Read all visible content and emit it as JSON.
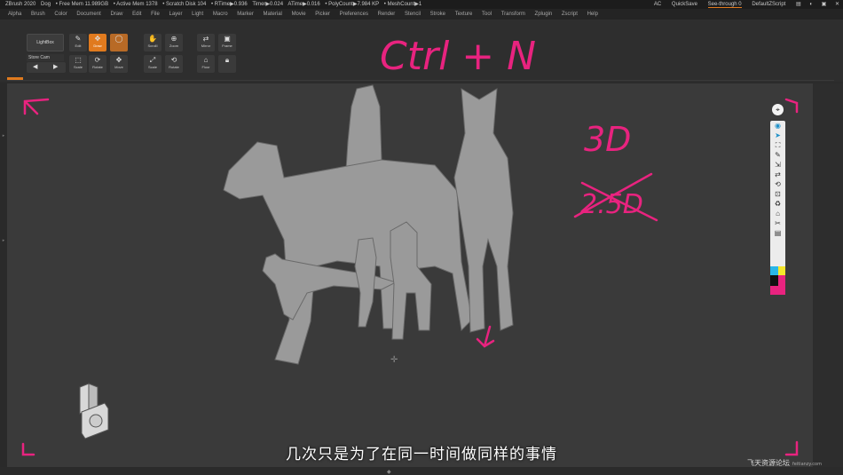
{
  "titlebar": {
    "app_name": "ZBrush 2020",
    "document": "Dog",
    "free_mem": "• Free Mem 11.989GB",
    "active_mem": "• Active Mem 1378",
    "scratch_disk": "• Scratch Disk 104",
    "rtime": "• RTime▶0.936",
    "timer": "Timer▶0.024",
    "atime": "ATime▶0.016",
    "polycount": "• PolyCount▶7.984 KP",
    "meshcount": "• MeshCount▶1",
    "ac": "AC",
    "quicksave": "QuickSave",
    "see_through": "See-through  0",
    "script": "DefaultZScript"
  },
  "menu": [
    "Alpha",
    "Brush",
    "Color",
    "Document",
    "Draw",
    "Edit",
    "File",
    "Layer",
    "Light",
    "Macro",
    "Marker",
    "Material",
    "Movie",
    "Picker",
    "Preferences",
    "Render",
    "Stencil",
    "Stroke",
    "Texture",
    "Tool",
    "Transform",
    "Zplugin",
    "Zscript",
    "Help"
  ],
  "shelf": {
    "lightbox": "LightBox",
    "store_cam": "Store Cam",
    "prev_arrow": "◀",
    "next_arrow": "▶",
    "tools": [
      {
        "label": "Edit",
        "icon": "✎"
      },
      {
        "label": "Draw",
        "icon": "✥"
      },
      {
        "label": "Move",
        "icon": "◯"
      },
      {
        "label": "Scale",
        "icon": "⬚"
      },
      {
        "label": "Rotate",
        "icon": "⟳"
      },
      {
        "label": "ScrollI",
        "icon": "✋"
      },
      {
        "label": "Zoom",
        "icon": "⊕"
      },
      {
        "label": "Mirror",
        "icon": "⇄"
      },
      {
        "label": "Frame",
        "icon": "▣"
      },
      {
        "label": "Move",
        "icon": "✥"
      },
      {
        "label": "Scale",
        "icon": "⤢"
      },
      {
        "label": "Rotate",
        "icon": "⟲"
      },
      {
        "label": "Floor",
        "icon": "⌂"
      }
    ]
  },
  "annotations": {
    "ctrl_n": "Ctrl + N",
    "three_d": "3D",
    "two_five_d": "2.5D",
    "ink_color": "#e8237f"
  },
  "right_shelf": {
    "pin": "⌖",
    "icons": [
      "◉",
      "➤",
      "⛶",
      "✎",
      "⇲",
      "⇄",
      "⟲",
      "⊡",
      "♻",
      "⌂",
      "✂",
      "▤"
    ]
  },
  "subtitle": "几次只是为了在同一时间做同样的事情",
  "watermark": {
    "main": "飞天资源论坛",
    "url": "feitianzy.com"
  },
  "colors": {
    "accent": "#e07a1e",
    "canvas": "#3a3a3a",
    "model": "#9a9a9a"
  }
}
